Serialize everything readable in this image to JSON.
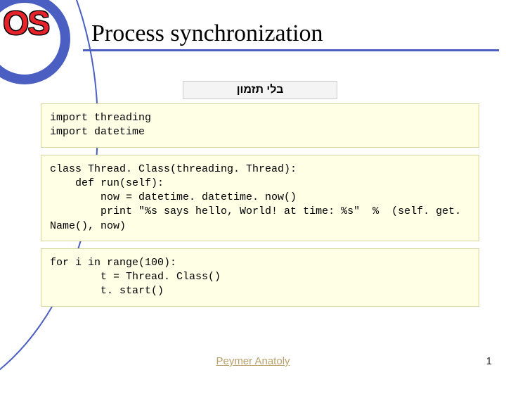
{
  "logo": {
    "text": "OS"
  },
  "title": "Process synchronization",
  "tag": "בלי תזמון",
  "code": {
    "block1": "import threading\nimport datetime",
    "block2": "class Thread. Class(threading. Thread):\n    def run(self):\n        now = datetime. datetime. now()\n        print \"%s says hello, World! at time: %s\"  %  (self. get. Name(), now)",
    "block3": "for i in range(100):\n        t = Thread. Class()\n        t. start()"
  },
  "footer": {
    "author": "Peymer Anatoly",
    "page": "1"
  }
}
